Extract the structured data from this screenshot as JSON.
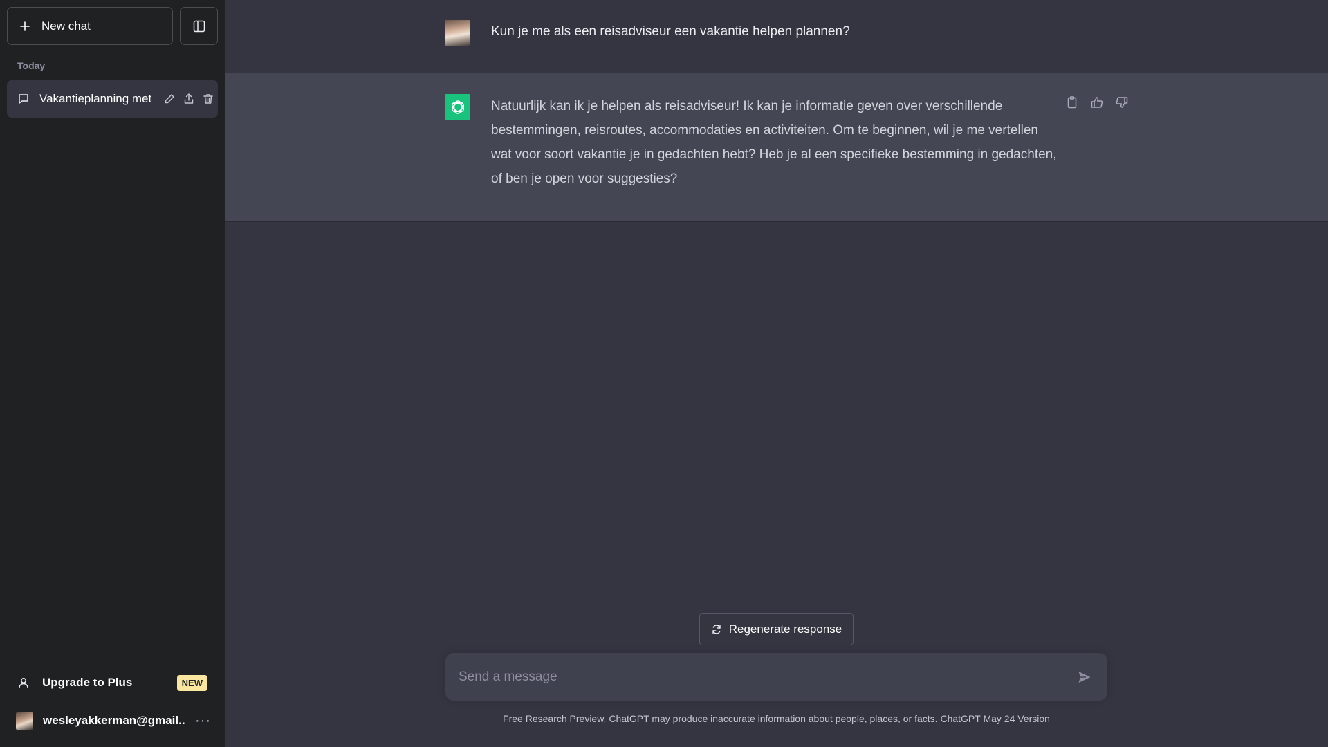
{
  "sidebar": {
    "new_chat_label": "New chat",
    "section_label": "Today",
    "chat_items": [
      {
        "title": "Vakantieplanning met reisadviseur"
      }
    ],
    "upgrade_label": "Upgrade to Plus",
    "upgrade_badge": "NEW",
    "user_email": "wesleyakkerman@gmail....",
    "more_label": "···"
  },
  "conversation": {
    "user_message": "Kun je me als een reisadviseur een vakantie helpen plannen?",
    "assistant_message": "Natuurlijk kan ik je helpen als reisadviseur! Ik kan je informatie geven over verschillende bestemmingen, reisroutes, accommodaties en activiteiten. Om te beginnen, wil je me vertellen wat voor soort vakantie je in gedachten hebt? Heb je al een specifieke bestemming in gedachten, of ben je open voor suggesties?"
  },
  "composer": {
    "regenerate_label": "Regenerate response",
    "placeholder": "Send a message"
  },
  "footer": {
    "text": "Free Research Preview. ChatGPT may produce inaccurate information about people, places, or facts. ",
    "link_text": "ChatGPT May 24 Version"
  },
  "colors": {
    "sidebar_bg": "#202123",
    "main_bg": "#343541",
    "assistant_bg": "#444654",
    "gpt_green": "#19c37d",
    "badge_yellow": "#fae69e"
  }
}
